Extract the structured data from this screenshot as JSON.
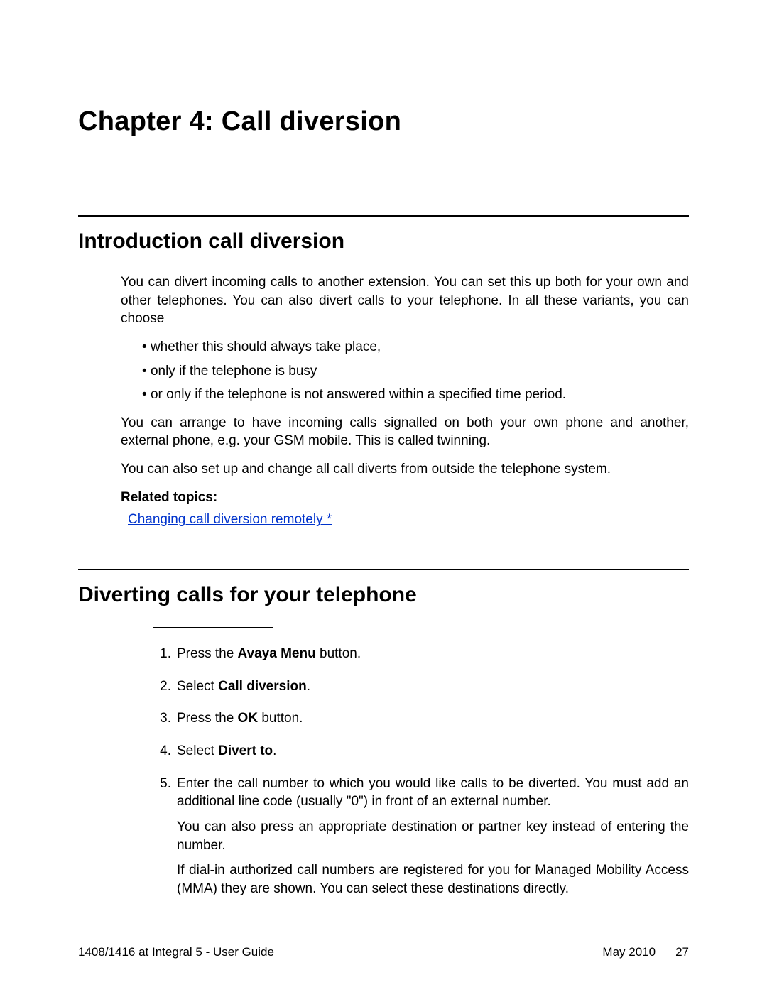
{
  "chapter": {
    "title": "Chapter 4:  Call diversion"
  },
  "section1": {
    "title": "Introduction call diversion",
    "p1": "You can divert incoming calls to another extension. You can set this up both for your own and other telephones. You can also divert calls to your telephone. In all these variants, you can choose",
    "bullets": {
      "b1": "whether this should always take place,",
      "b2": "only if the telephone is busy",
      "b3": "or only if the telephone is not answered within a specified time period."
    },
    "p2": "You can arrange to have incoming calls signalled on both your own phone and another, external phone, e.g. your GSM mobile. This is called twinning.",
    "p3": "You can also set up and change all call diverts from outside the telephone system.",
    "related_label": "Related topics:",
    "related_link": "Changing call diversion remotely *"
  },
  "section2": {
    "title": "Diverting calls for your telephone",
    "steps": {
      "n1": "1.",
      "t1a": "Press the ",
      "t1b": "Avaya Menu",
      "t1c": " button.",
      "n2": "2.",
      "t2a": "Select ",
      "t2b": "Call diversion",
      "t2c": ".",
      "n3": "3.",
      "t3a": "Press the ",
      "t3b": "OK",
      "t3c": " button.",
      "n4": "4.",
      "t4a": "Select ",
      "t4b": "Divert to",
      "t4c": ".",
      "n5": "5.",
      "t5p1": "Enter the call number to which you would like calls to be diverted. You must add an additional line code (usually \"0\") in front of an external number.",
      "t5p2": "You can also press an appropriate destination or partner key instead of entering the number.",
      "t5p3": "If dial-in authorized call numbers are registered for you for Managed Mobility Access (MMA) they are shown. You can select these destinations directly."
    }
  },
  "footer": {
    "left": "1408/1416 at Integral 5 - User Guide",
    "date": "May 2010",
    "page": "27"
  }
}
